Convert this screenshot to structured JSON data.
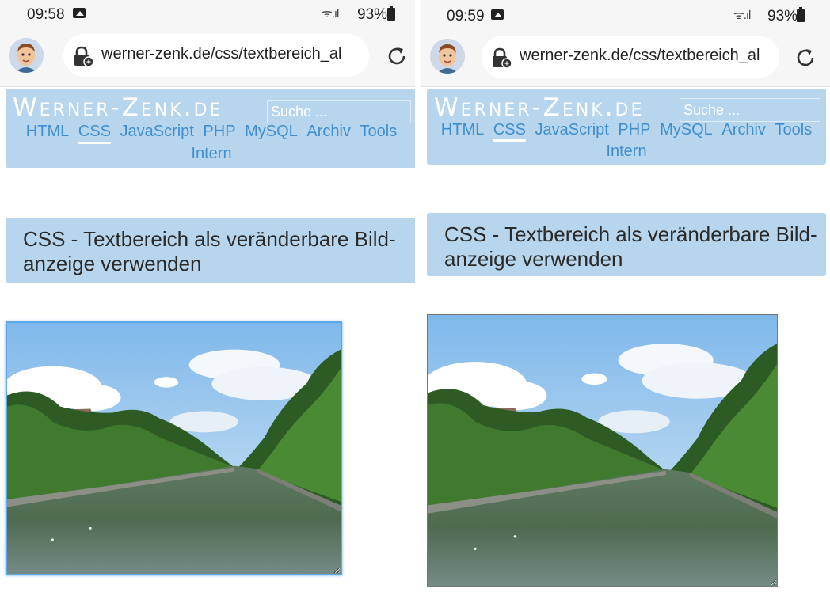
{
  "colors": {
    "header_bg": "#b7d5ec",
    "nav_link": "#3f8fd0",
    "title_text": "#2a2a2a",
    "focus_border": "#5ea8e8"
  },
  "panes": [
    {
      "status": {
        "time": "09:58",
        "signal": "ᯤ.ıl",
        "battery": "93%"
      },
      "browser": {
        "url": "werner-zenk.de/css/textbereich_al"
      },
      "site": {
        "logo": "Werner-Zenk.de",
        "search_placeholder": "Suche ...",
        "nav": [
          "HTML",
          "CSS",
          "JavaScript",
          "PHP",
          "MySQL",
          "Archiv",
          "Tools",
          "Intern"
        ],
        "nav_active": "CSS"
      },
      "page_title": "CSS - Textbereich als veränderbare Bild-anzeige verwenden"
    },
    {
      "status": {
        "time": "09:59",
        "signal": "ᯤ.ıl",
        "battery": "93%"
      },
      "browser": {
        "url": "werner-zenk.de/css/textbereich_al"
      },
      "site": {
        "logo": "Werner-Zenk.de",
        "search_placeholder": "Suche ...",
        "nav": [
          "HTML",
          "CSS",
          "JavaScript",
          "PHP",
          "MySQL",
          "Archiv",
          "Tools",
          "Intern"
        ],
        "nav_active": "CSS"
      },
      "page_title": "CSS - Textbereich als veränderbare Bild-anzeige verwenden"
    }
  ]
}
